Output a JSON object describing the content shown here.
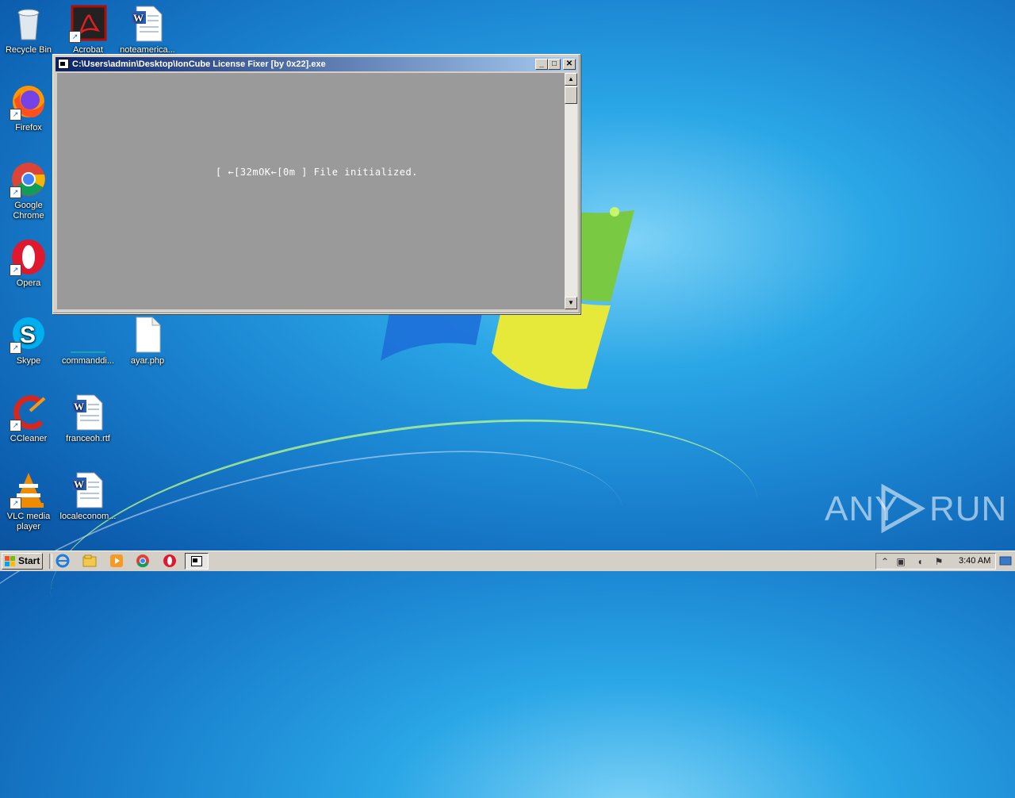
{
  "desktop": {
    "icons": [
      {
        "label": "Recycle Bin"
      },
      {
        "label": "Acrobat"
      },
      {
        "label": "noteamerica..."
      },
      {
        "label": "Firefox"
      },
      {
        "label": "Google Chrome"
      },
      {
        "label": "Opera"
      },
      {
        "label": "Skype"
      },
      {
        "label": "commanddi..."
      },
      {
        "label": "ayar.php"
      },
      {
        "label": "CCleaner"
      },
      {
        "label": "franceoh.rtf"
      },
      {
        "label": "VLC media player"
      },
      {
        "label": "localeconom..."
      }
    ]
  },
  "console": {
    "title": "C:\\Users\\admin\\Desktop\\IonCube License Fixer [by 0x22].exe",
    "output_line": "[ ←[32mOK←[0m ] File initialized.",
    "buttons": {
      "minimize": "_",
      "maximize": "□",
      "close": "✕"
    }
  },
  "taskbar": {
    "start_label": "Start",
    "quick_launch": [
      "ie-icon",
      "explorer-icon",
      "media-player-icon",
      "chrome-icon",
      "opera-icon"
    ],
    "clock": "3:40 AM"
  },
  "watermark": {
    "left": "ANY",
    "right": "RUN"
  },
  "colors": {
    "console_bg": "#9a9a9a",
    "title_bar": "#0a246a",
    "taskbar": "#d4d0c8"
  }
}
